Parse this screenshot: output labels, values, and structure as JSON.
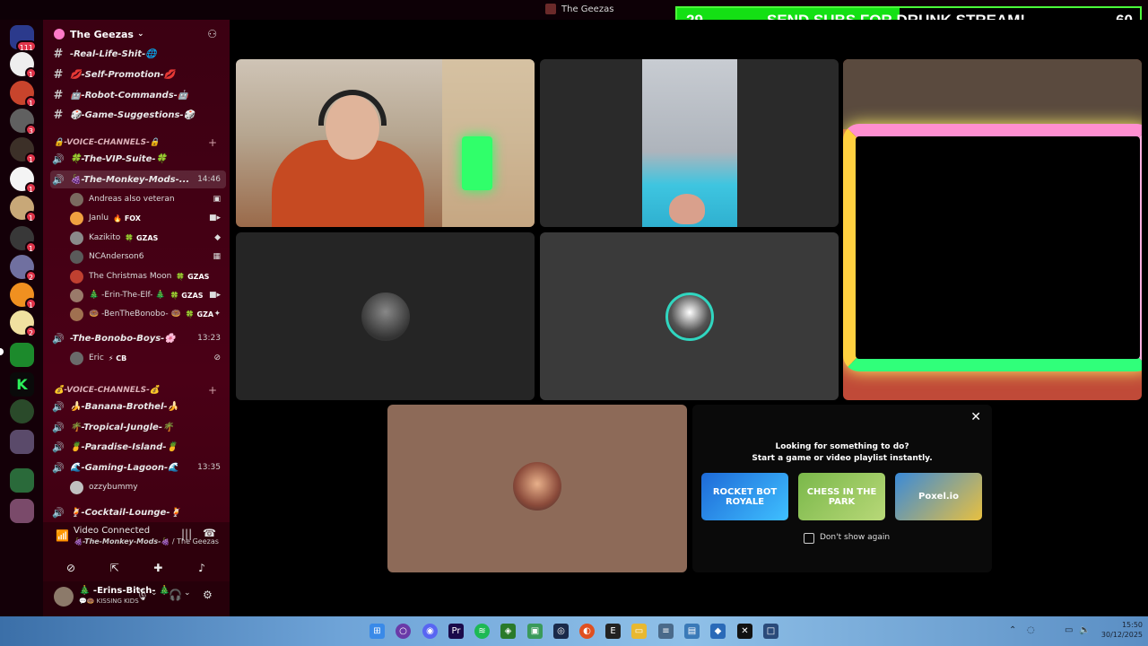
{
  "window": {
    "title": "The Geezas"
  },
  "overlay": {
    "left_count": "29",
    "message": "SEND SUBS FOR DRUNK STREAM!",
    "right_count": "60",
    "progress": 0.48,
    "fill_color": "#14e014"
  },
  "rail": {
    "top_badge": "111",
    "servers": [
      {
        "badge": "1"
      },
      {
        "badge": "1"
      },
      {
        "badge": "3"
      },
      {
        "badge": "1"
      },
      {
        "badge": "1"
      },
      {
        "badge": "1"
      },
      {
        "badge": "1"
      },
      {
        "badge": "2"
      },
      {
        "badge": "1"
      },
      {
        "badge": "2"
      }
    ]
  },
  "server": {
    "name": "The Geezas"
  },
  "channels": {
    "text": [
      {
        "name": "-Real-Life-Shit-🌐"
      },
      {
        "name": "💋-Self-Promotion-💋"
      },
      {
        "name": "🤖-Robot-Commands-🤖"
      },
      {
        "name": "🎲-Game-Suggestions-🎲"
      }
    ],
    "category1": "🔒-VOICE-CHANNELS-🔒",
    "vip": "🍀-The-VIP-Suite-🍀",
    "monkey": {
      "name": "🍇-The-Monkey-Mods-...",
      "time": "14:46"
    },
    "monkey_users": [
      {
        "name": "Andreas also veteran",
        "tag": ""
      },
      {
        "name": "Janlu",
        "tag": "🔥 FOX"
      },
      {
        "name": "Kazikito",
        "tag": "🍀 GZAS"
      },
      {
        "name": "NCAnderson6",
        "tag": ""
      },
      {
        "name": "The Christmas Moon",
        "tag": "🍀 GZAS"
      },
      {
        "name": "🎄 -Erin-The-Elf- 🎄",
        "tag": "🍀 GZAS"
      },
      {
        "name": "🍩 -BenTheBonobo- 🍩",
        "tag": "🍀 GZA"
      }
    ],
    "bonobo": {
      "name": "-The-Bonobo-Boys-🌸",
      "time": "13:23"
    },
    "bonobo_users": [
      {
        "name": "Eric",
        "tag": "⚡ CB"
      }
    ],
    "category2": "💰-VOICE-CHANNELS-💰",
    "voice2": [
      {
        "name": "🍌-Banana-Brothel-🍌"
      },
      {
        "name": "🌴-Tropical-Jungle-🌴"
      },
      {
        "name": "🍍-Paradise-Island-🍍"
      }
    ],
    "lagoon": {
      "name": "🌊-Gaming-Lagoon-🌊",
      "time": "13:35"
    },
    "lagoon_users": [
      {
        "name": "ozzybummy",
        "tag": ""
      }
    ],
    "cocktail": "🍹-Cocktail-Lounge-🍹"
  },
  "voice_panel": {
    "status": "Video Connected",
    "channel": "🍇-The-Monkey-Mods-🍇",
    "server": " / The Geezas"
  },
  "user": {
    "name": "🎄 -Erins-Bitch- 🎄",
    "status": "💬🍩 KISSING KIDS"
  },
  "activity": {
    "line1": "Looking for something to do?",
    "line2": "Start a game or video playlist instantly.",
    "games": [
      {
        "label": "ROCKET BOT ROYALE"
      },
      {
        "label": "CHESS IN THE PARK"
      },
      {
        "label": "Poxel.io"
      }
    ],
    "dont_show": "Don't show again"
  },
  "clock": {
    "time": "15:50",
    "date": "30/12/2025"
  }
}
